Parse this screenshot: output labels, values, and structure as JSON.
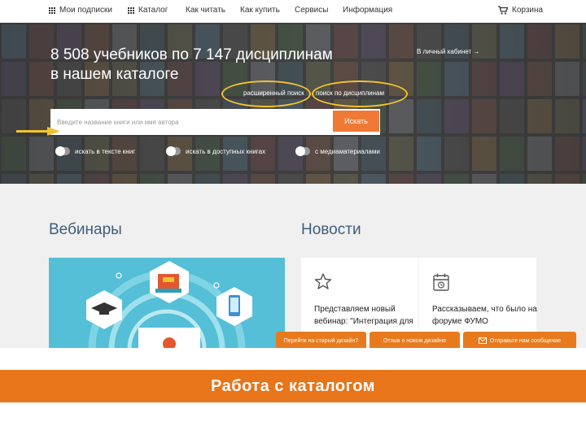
{
  "nav": {
    "subscriptions": "Мои подписки",
    "catalog": "Каталог",
    "how_to_read": "Как читать",
    "how_to_buy": "Как купить",
    "services": "Сервисы",
    "info": "Информация",
    "cart": "Корзина"
  },
  "hero": {
    "title_line1": "8 508 учебников по 7 147 дисциплинам",
    "title_line2": "в нашем каталоге",
    "cabinet_link": "В личный кабинет →",
    "advanced_search": "расширенный поиск",
    "discipline_search": "поиск по дисциплинам",
    "search_placeholder": "Введите название книги или имя автора",
    "search_button": "Искать",
    "toggles": [
      {
        "label": "искать в тексте книг"
      },
      {
        "label": "искать в доступных книгах"
      },
      {
        "label": "с медиаматериалами"
      }
    ]
  },
  "webinars": {
    "title": "Вебинары"
  },
  "news": {
    "title": "Новости",
    "items": [
      {
        "text": "Представляем новый вебинар: \"Интеграция для",
        "icon": "star-icon"
      },
      {
        "text": "Рассказываем, что было на форуме ФУМО",
        "icon": "calendar-icon"
      }
    ]
  },
  "feedback_tabs": {
    "old_design": "Перейти на старый дизайн?",
    "review": "Отзыв о новом дизайне",
    "message": "Отправьте нам сообщение"
  },
  "banner": {
    "text": "Работа с каталогом"
  },
  "colors": {
    "accent": "#f07a35",
    "highlight": "#f2c230",
    "banner": "#e8751a",
    "heading": "#3f5e7c",
    "webinar_bg": "#54bfd6"
  }
}
